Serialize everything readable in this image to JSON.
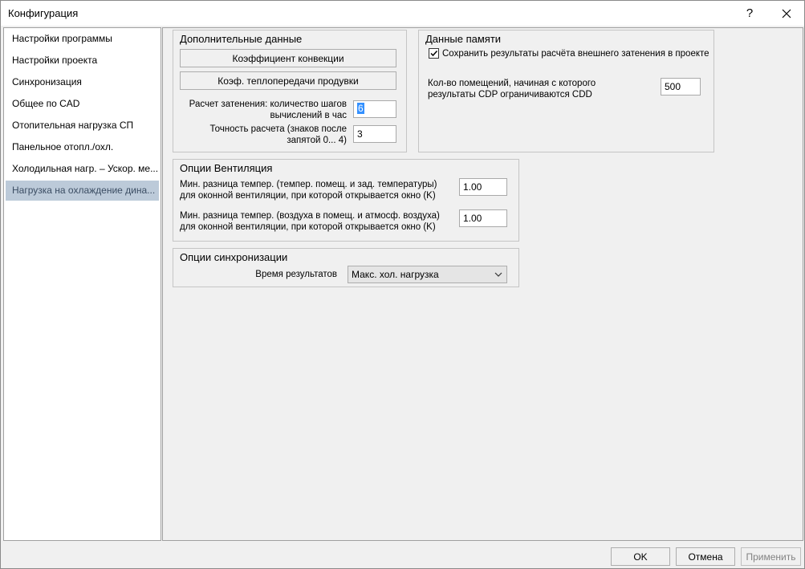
{
  "window": {
    "title": "Конфигурация",
    "help_label": "?",
    "close_label": "✕"
  },
  "sidebar": {
    "items": [
      {
        "label": "Настройки программы",
        "selected": false
      },
      {
        "label": "Настройки проекта",
        "selected": false
      },
      {
        "label": "Синхронизация",
        "selected": false
      },
      {
        "label": "Общее по CAD",
        "selected": false
      },
      {
        "label": "Отопительная нагрузка СП",
        "selected": false
      },
      {
        "label": "Панельное отопл./охл.",
        "selected": false
      },
      {
        "label": "Холодильная нагр. – Ускор. ме...",
        "selected": false
      },
      {
        "label": "Нагрузка на охлаждение дина...",
        "selected": true
      }
    ]
  },
  "additional": {
    "title": "Дополнительные данные",
    "convection_button": "Коэффициент конвекции",
    "blowdown_button": "Коэф. теплопередачи продувки",
    "shading_label": "Расчет затенения: количество шагов вычислений в час",
    "shading_value": "6",
    "precision_label": "Точность расчета (знаков после запятой 0... 4)",
    "precision_value": "3"
  },
  "memory": {
    "title": "Данные памяти",
    "save_checkbox_label": "Сохранить результаты расчёта внешнего затенения в проекте",
    "save_checked": true,
    "rooms_label": "Кол-во помещений, начиная с которого результаты CDP ограничиваются CDD",
    "rooms_value": "500"
  },
  "ventilation": {
    "title": "Опции Вентиляция",
    "diff1_label": "Мин. разница темпер. (темпер. помещ. и зад. температуры) для оконной вентиляции, при которой открывается окно (K)",
    "diff1_value": "1.00",
    "diff2_label": "Мин. разница темпер. (воздуха в помещ. и атмосф. воздуха) для оконной вентиляции, при которой открывается окно (K)",
    "diff2_value": "1.00"
  },
  "sync": {
    "title": "Опции синхронизации",
    "time_label": "Время результатов",
    "time_value": "Макс. хол. нагрузка"
  },
  "footer": {
    "ok_label": "OK",
    "cancel_label": "Отмена",
    "apply_label": "Применить",
    "apply_enabled": false
  }
}
